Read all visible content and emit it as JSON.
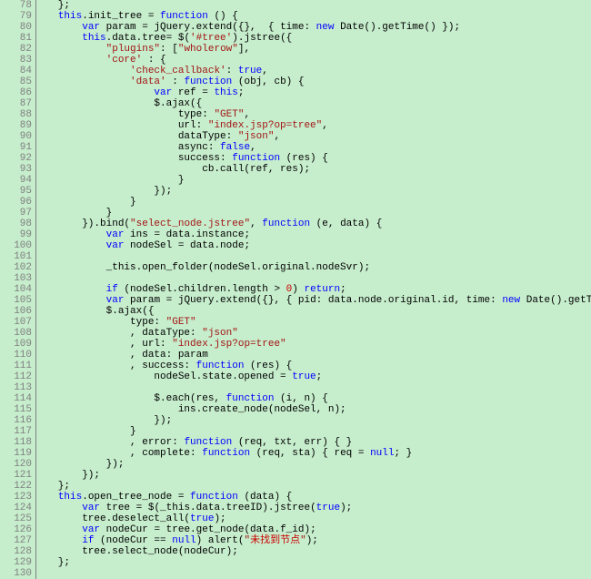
{
  "line_start": 78,
  "lines": [
    "   };",
    "   <kw>this</kw>.init_tree = <kw>function</kw> () {",
    "       <kw>var</kw> param = jQuery.extend({},  { time: <kw>new</kw> Date().getTime() });",
    "       <kw>this</kw>.data.tree= $(<str>'#tree'</str>).jstree({",
    "           <str>\"plugins\"</str>: [<str>\"wholerow\"</str>],",
    "           <str>'core'</str> : {",
    "               <str>'check_callback'</str>: <kw>true</kw>,",
    "               <str>'data'</str> : <kw>function</kw> (obj, cb) {",
    "                   <kw>var</kw> ref = <kw>this</kw>;",
    "                   $.ajax({",
    "                       type: <str>\"GET\"</str>,",
    "                       url: <str>\"index.jsp?op=tree\"</str>,",
    "                       dataType: <str>\"json\"</str>,",
    "                       async: <kw>false</kw>,",
    "                       success: <kw>function</kw> (res) {",
    "                           cb.call(ref, res);",
    "                       }",
    "                   });",
    "               }",
    "           }",
    "       }).bind(<str>\"select_node.jstree\"</str>, <kw>function</kw> (e, data) {",
    "           <kw>var</kw> ins = data.instance;",
    "           <kw>var</kw> nodeSel = data.node;",
    "",
    "           _this.open_folder(nodeSel.original.nodeSvr);",
    "",
    "           <kw>if</kw> (nodeSel.children.length &gt; <num>0</num>) <kw>return</kw>;",
    "           <kw>var</kw> param = jQuery.extend({}, { pid: data.node.original.id, time: <kw>new</kw> Date().getTime() });",
    "           $.ajax({",
    "               type: <str>\"GET\"</str>",
    "               , dataType: <str>\"json\"</str>",
    "               , url: <str>\"index.jsp?op=tree\"</str>",
    "               , data: param",
    "               , success: <kw>function</kw> (res) {",
    "                   nodeSel.state.opened = <kw>true</kw>;",
    "",
    "                   $.each(res, <kw>function</kw> (i, n) {",
    "                       ins.create_node(nodeSel, n);",
    "                   });",
    "               }",
    "               , error: <kw>function</kw> (req, txt, err) { }",
    "               , complete: <kw>function</kw> (req, sta) { req = <kw>null</kw>; }",
    "           });",
    "       });",
    "   };",
    "   <kw>this</kw>.open_tree_node = <kw>function</kw> (data) {",
    "       <kw>var</kw> tree = $(_this.data.treeID).jstree(<kw>true</kw>);",
    "       tree.deselect_all(<kw>true</kw>);",
    "       <kw>var</kw> nodeCur = tree.get_node(data.f_id);",
    "       <kw>if</kw> (nodeCur == <kw>null</kw>) alert(<str>\"</str><cn>未找到节点</cn><str>\"</str>);",
    "       tree.select_node(nodeCur);",
    "   };",
    ""
  ]
}
